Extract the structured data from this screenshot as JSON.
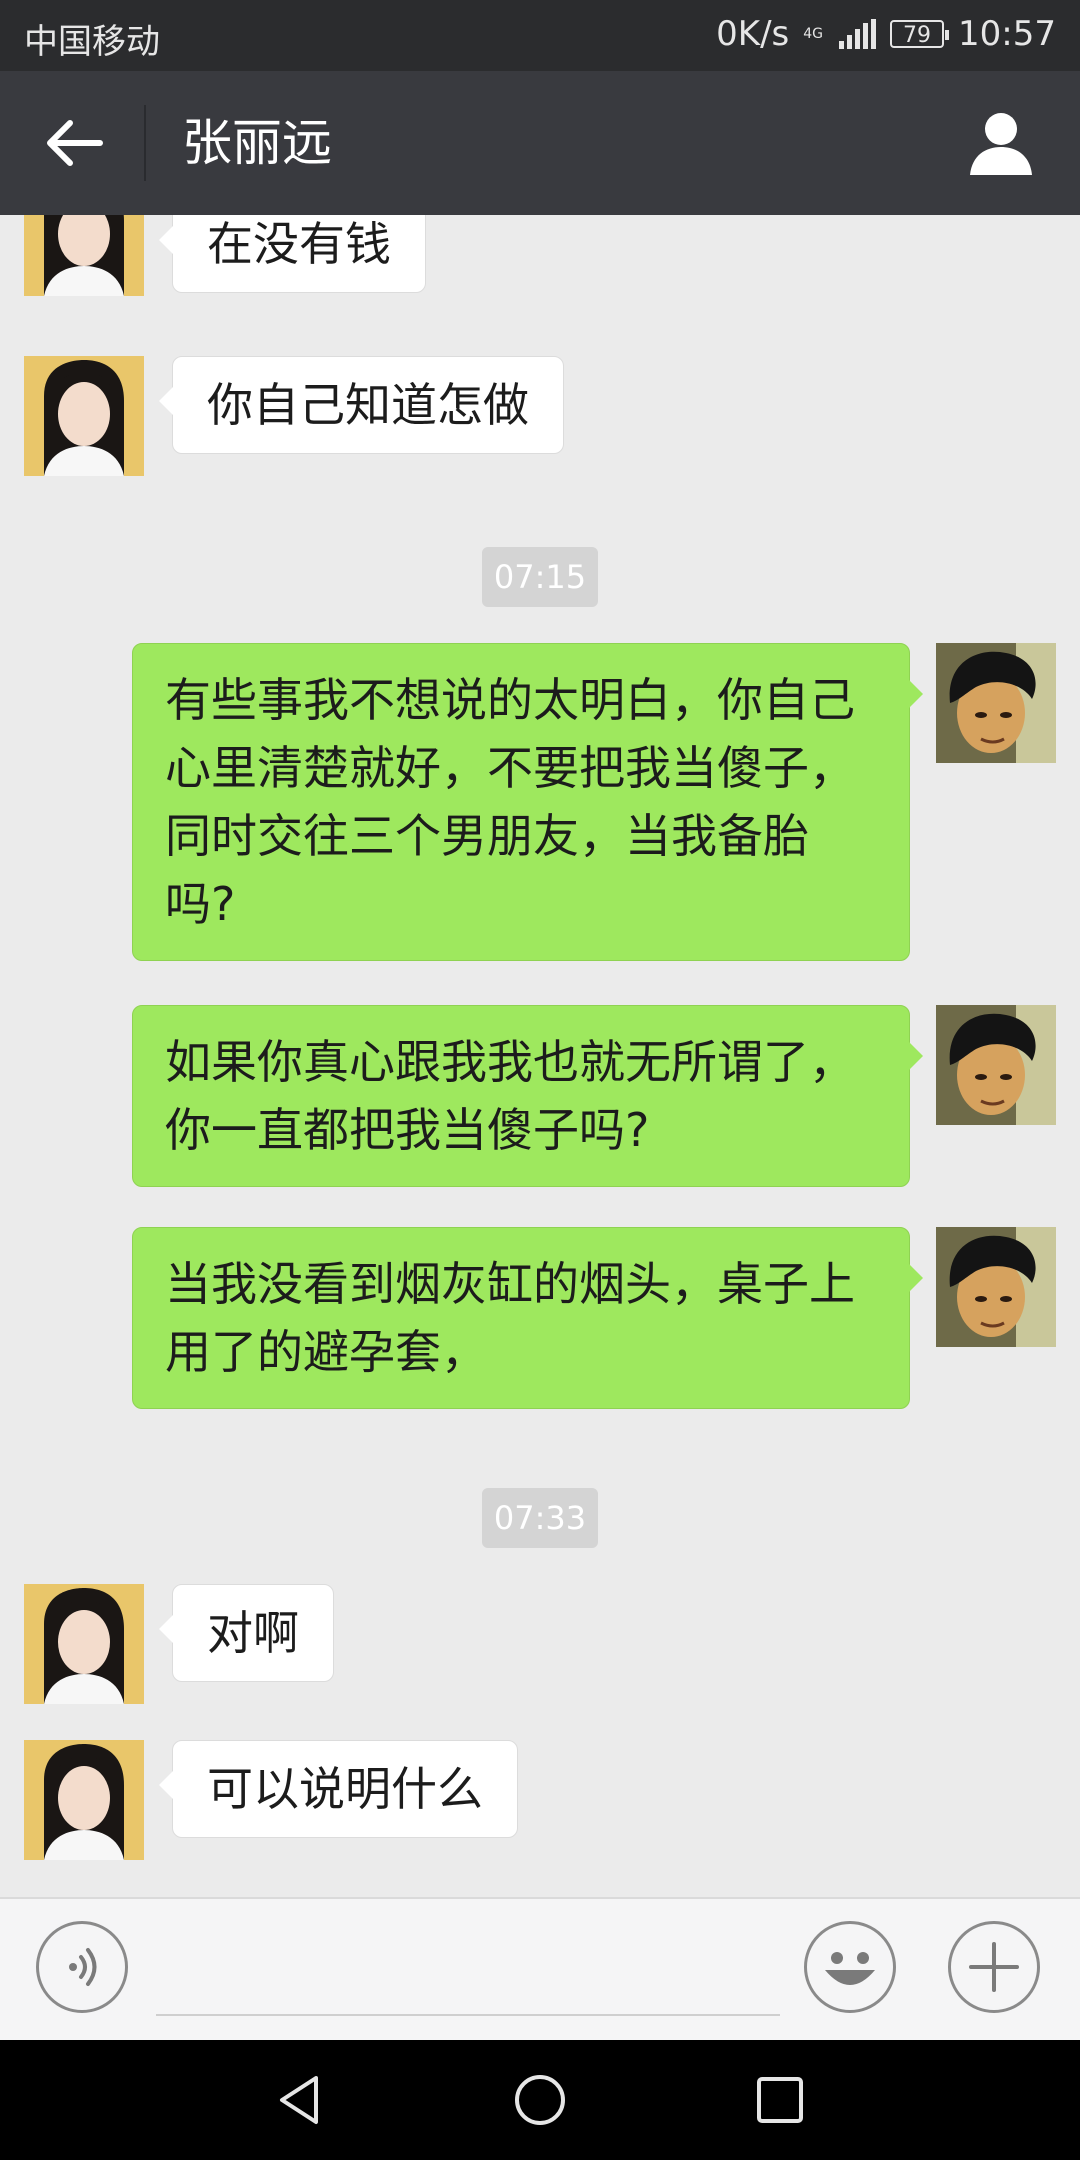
{
  "status_bar": {
    "carrier": "中国移动",
    "net_speed": "0K/s",
    "network_type": "4G",
    "battery": "79",
    "time": "10:57"
  },
  "header": {
    "back_icon": "arrow-left-icon",
    "title": "张丽远",
    "profile_icon": "person-icon"
  },
  "messages": [
    {
      "side": "in",
      "text": "在没有钱"
    },
    {
      "side": "in",
      "text": "你自己知道怎做"
    },
    {
      "type": "time",
      "text": "07:15"
    },
    {
      "side": "out",
      "lines": [
        "有些事我不想说的太明白，你自己",
        "心里清楚就好，不要把我当傻子，",
        "同时交往三个男朋友，当我备胎",
        "吗?"
      ]
    },
    {
      "side": "out",
      "lines": [
        "如果你真心跟我我也就无所谓了，",
        "你一直都把我当傻子吗?"
      ]
    },
    {
      "side": "out",
      "lines": [
        "当我没看到烟灰缸的烟头，桌子上",
        "用了的避孕套，"
      ]
    },
    {
      "type": "time",
      "text": "07:33"
    },
    {
      "side": "in",
      "text": "对啊"
    },
    {
      "side": "in",
      "text": "可以说明什么"
    }
  ],
  "input_bar": {
    "voice_icon": "voice-icon",
    "emoji_icon": "emoji-icon",
    "more_icon": "plus-icon"
  },
  "colors": {
    "outgoing_bubble": "#9ee85e",
    "incoming_bubble": "#ffffff",
    "chat_background": "#ebebeb",
    "title_bar": "#393a3f"
  }
}
